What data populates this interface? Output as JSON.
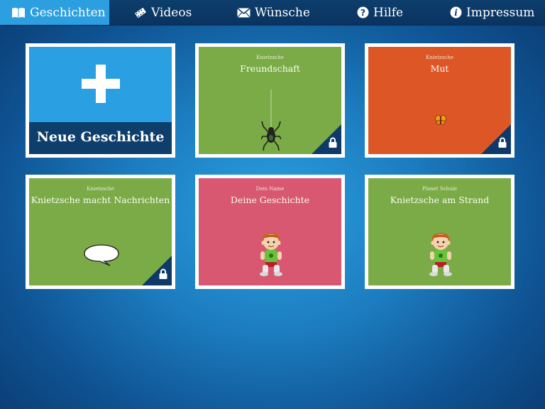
{
  "nav": [
    {
      "label": "Geschichten",
      "icon": "book-icon",
      "active": true
    },
    {
      "label": "Videos",
      "icon": "film-icon",
      "active": false
    },
    {
      "label": "Wünsche",
      "icon": "envelope-icon",
      "active": false
    },
    {
      "label": "Hilfe",
      "icon": "question-icon",
      "active": false
    },
    {
      "label": "Impressum",
      "icon": "info-icon",
      "active": false
    }
  ],
  "new_story": {
    "label": "Neue Geschichte"
  },
  "cards": [
    {
      "author": "Knietzsche",
      "title": "Freundschaft",
      "color": "#7aab47",
      "locked": true,
      "image": "spider-icon"
    },
    {
      "author": "Knietzsche",
      "title": "Mut",
      "color": "#dd5626",
      "locked": true,
      "image": "butterfly-icon"
    },
    {
      "author": "Knietzsche",
      "title": "Knietzsche macht Nachrichten",
      "color": "#7aab47",
      "locked": true,
      "image": "speech-bubble-icon"
    },
    {
      "author": "Dein Name",
      "title": "Deine Geschichte",
      "color": "#d75870",
      "locked": false,
      "image": "boy-icon"
    },
    {
      "author": "Planet Schule",
      "title": "Knietzsche am Strand",
      "color": "#7aab47",
      "locked": false,
      "image": "boy-icon"
    }
  ],
  "colors": {
    "accent": "#2b9fe0",
    "nav": "#0d3e6c",
    "lock_corner": "#0d3a69"
  }
}
